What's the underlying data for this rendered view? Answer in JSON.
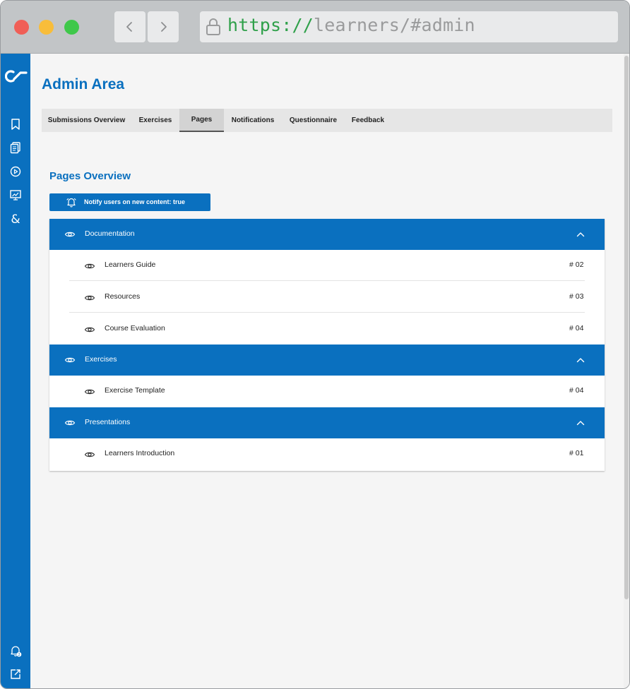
{
  "browser": {
    "url_scheme": "https://",
    "url_path": "learners/#admin"
  },
  "page": {
    "title": "Admin Area"
  },
  "tabs": [
    {
      "label": "Submissions Overview",
      "active": false
    },
    {
      "label": "Exercises",
      "active": false
    },
    {
      "label": "Pages",
      "active": true
    },
    {
      "label": "Notifications",
      "active": false
    },
    {
      "label": "Questionnaire",
      "active": false
    },
    {
      "label": "Feedback",
      "active": false
    }
  ],
  "pages_overview": {
    "title": "Pages Overview",
    "notify_label": "Notify users on new content: true",
    "groups": [
      {
        "label": "Documentation",
        "items": [
          {
            "label": "Learners Guide",
            "num": "# 02"
          },
          {
            "label": "Resources",
            "num": "# 03"
          },
          {
            "label": "Course Evaluation",
            "num": "# 04"
          }
        ]
      },
      {
        "label": "Exercises",
        "items": [
          {
            "label": "Exercise Template",
            "num": "# 04"
          }
        ]
      },
      {
        "label": "Presentations",
        "items": [
          {
            "label": "Learners Introduction",
            "num": "# 01"
          }
        ]
      }
    ]
  },
  "sidebar": {
    "icons": [
      "logo-icon",
      "bookmark-icon",
      "documents-icon",
      "play-icon",
      "presentation-icon",
      "ampersand-icon",
      "notification-bell-icon",
      "external-link-icon"
    ]
  },
  "colors": {
    "accent": "#0a70bf",
    "background": "#f5f5f5"
  }
}
